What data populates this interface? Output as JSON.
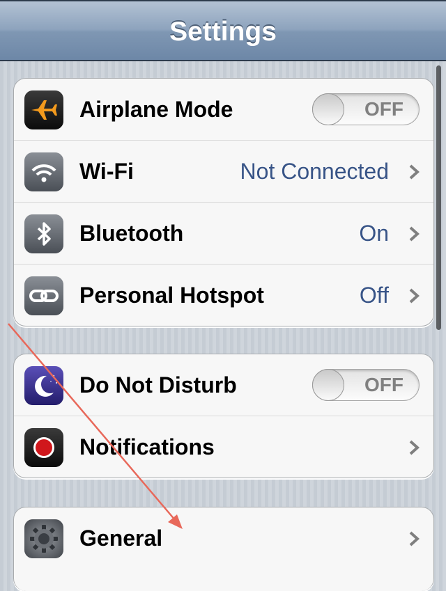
{
  "navbar": {
    "title": "Settings"
  },
  "groups": [
    {
      "rows": [
        {
          "label": "Airplane Mode",
          "icon": "airplane-icon",
          "toggle": "OFF"
        },
        {
          "label": "Wi-Fi",
          "icon": "wifi-icon",
          "value": "Not Connected"
        },
        {
          "label": "Bluetooth",
          "icon": "bluetooth-icon",
          "value": "On"
        },
        {
          "label": "Personal Hotspot",
          "icon": "hotspot-icon",
          "value": "Off"
        }
      ]
    },
    {
      "rows": [
        {
          "label": "Do Not Disturb",
          "icon": "moon-icon",
          "toggle": "OFF"
        },
        {
          "label": "Notifications",
          "icon": "notifications-icon"
        }
      ]
    },
    {
      "rows": [
        {
          "label": "General",
          "icon": "gear-icon"
        }
      ]
    }
  ],
  "colors": {
    "value_text": "#385487",
    "annotation_arrow": "#e8685a",
    "navbar": "#8da3bd"
  }
}
